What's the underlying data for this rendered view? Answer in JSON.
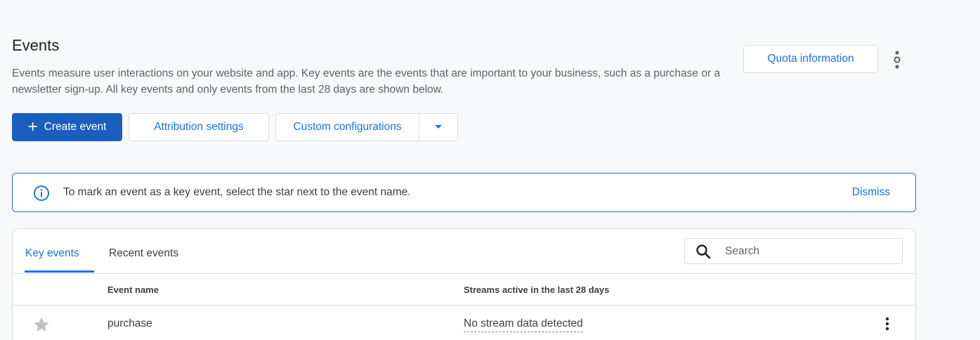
{
  "header": {
    "title": "Events",
    "description": "Events measure user interactions on your website and app. Key events are the events that are important to your business, such as a purchase or a newsletter sign-up. All key events and only events from the last 28 days are shown below.",
    "quota_label": "Quota information",
    "more_icon": "more-vert-icon"
  },
  "actions": {
    "create_label": "Create event",
    "attribution_label": "Attribution settings",
    "custom_label": "Custom configurations"
  },
  "banner": {
    "message": "To mark an event as a key event, select the star next to the event name.",
    "dismiss_label": "Dismiss"
  },
  "table": {
    "tabs": [
      {
        "label": "Key events",
        "active": true
      },
      {
        "label": "Recent events",
        "active": false
      }
    ],
    "search_placeholder": "Search",
    "columns": [
      "Event name",
      "Streams active in the last 28 days"
    ],
    "rows": [
      {
        "name": "purchase",
        "streams": "No stream data detected",
        "starred": false
      }
    ]
  },
  "colors": {
    "accent": "#1a73e8",
    "primary_button": "#1a5fbf",
    "background": "#f8f9fa"
  }
}
